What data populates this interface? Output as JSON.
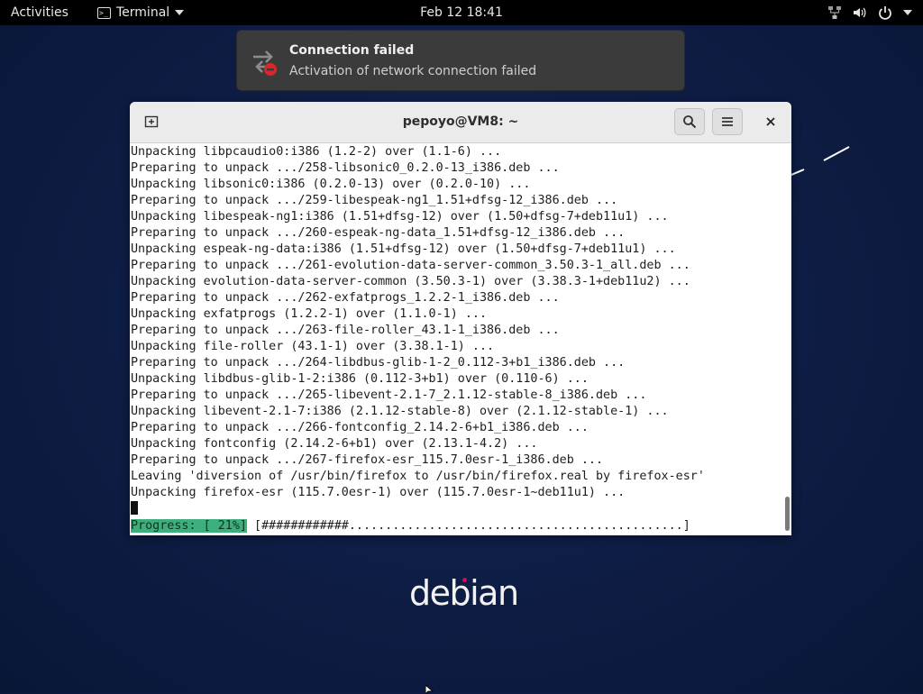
{
  "topbar": {
    "activities": "Activities",
    "app_menu": "Terminal",
    "clock": "Feb 12  18:41",
    "icons": [
      "network-icon",
      "volume-icon",
      "power-icon",
      "chevron-down-icon"
    ]
  },
  "notification": {
    "title": "Connection failed",
    "body": "Activation of network connection failed",
    "icon": "network-error-icon"
  },
  "window": {
    "title": "pepoyo@VM8: ~"
  },
  "terminal": {
    "lines": [
      "Unpacking libpcaudio0:i386 (1.2-2) over (1.1-6) ...",
      "Preparing to unpack .../258-libsonic0_0.2.0-13_i386.deb ...",
      "Unpacking libsonic0:i386 (0.2.0-13) over (0.2.0-10) ...",
      "Preparing to unpack .../259-libespeak-ng1_1.51+dfsg-12_i386.deb ...",
      "Unpacking libespeak-ng1:i386 (1.51+dfsg-12) over (1.50+dfsg-7+deb11u1) ...",
      "Preparing to unpack .../260-espeak-ng-data_1.51+dfsg-12_i386.deb ...",
      "Unpacking espeak-ng-data:i386 (1.51+dfsg-12) over (1.50+dfsg-7+deb11u1) ...",
      "Preparing to unpack .../261-evolution-data-server-common_3.50.3-1_all.deb ...",
      "Unpacking evolution-data-server-common (3.50.3-1) over (3.38.3-1+deb11u2) ...",
      "Preparing to unpack .../262-exfatprogs_1.2.2-1_i386.deb ...",
      "Unpacking exfatprogs (1.2.2-1) over (1.1.0-1) ...",
      "Preparing to unpack .../263-file-roller_43.1-1_i386.deb ...",
      "Unpacking file-roller (43.1-1) over (3.38.1-1) ...",
      "Preparing to unpack .../264-libdbus-glib-1-2_0.112-3+b1_i386.deb ...",
      "Unpacking libdbus-glib-1-2:i386 (0.112-3+b1) over (0.110-6) ...",
      "Preparing to unpack .../265-libevent-2.1-7_2.1.12-stable-8_i386.deb ...",
      "Unpacking libevent-2.1-7:i386 (2.1.12-stable-8) over (2.1.12-stable-1) ...",
      "Preparing to unpack .../266-fontconfig_2.14.2-6+b1_i386.deb ...",
      "Unpacking fontconfig (2.14.2-6+b1) over (2.13.1-4.2) ...",
      "Preparing to unpack .../267-firefox-esr_115.7.0esr-1_i386.deb ...",
      "Leaving 'diversion of /usr/bin/firefox to /usr/bin/firefox.real by firefox-esr'",
      "Unpacking firefox-esr (115.7.0esr-1) over (115.7.0esr-1~deb11u1) ..."
    ],
    "progress_label": "Progress: [ 21%]",
    "progress_bar": " [############..............................................]",
    "progress_percent": 21
  },
  "desktop": {
    "logo_text": "debian"
  },
  "colors": {
    "progress_accent": "#3dae7c",
    "error_red": "#d9262b",
    "debian_red": "#d70751"
  }
}
